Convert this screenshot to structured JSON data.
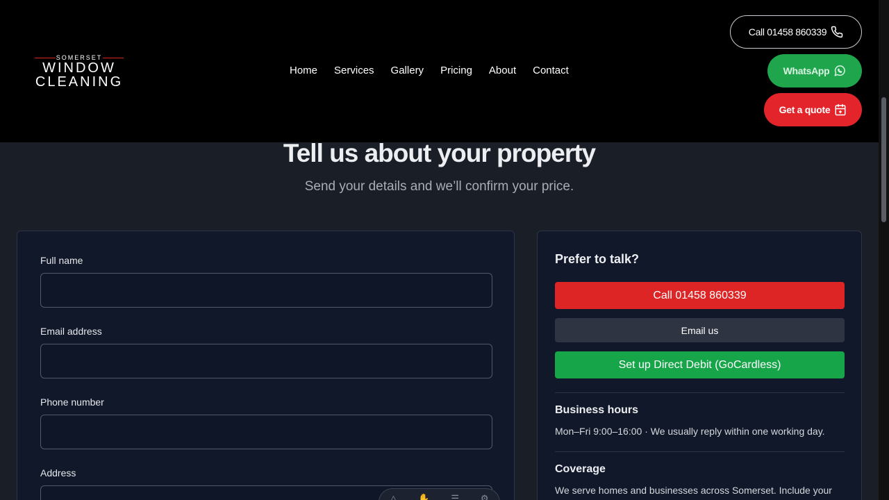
{
  "brand": {
    "logo_top": "SOMERSET",
    "logo_line1": "WINDOW",
    "logo_line2": "CLEANING"
  },
  "nav": {
    "items": [
      "Home",
      "Services",
      "Gallery",
      "Pricing",
      "About",
      "Contact"
    ]
  },
  "header_buttons": {
    "call": "Call 01458 860339",
    "whatsapp": "WhatsApp",
    "quote": "Get a quote"
  },
  "hero": {
    "title": "Tell us about your property",
    "subtitle": "Send your details and we’ll confirm your price."
  },
  "form": {
    "fields": [
      {
        "label": "Full name",
        "value": ""
      },
      {
        "label": "Email address",
        "value": ""
      },
      {
        "label": "Phone number",
        "value": ""
      },
      {
        "label": "Address",
        "value": ""
      }
    ]
  },
  "contact_card": {
    "title": "Prefer to talk?",
    "call_button": "Call 01458 860339",
    "email_button": "Email us",
    "direct_debit_button": "Set up Direct Debit (GoCardless)",
    "hours_title": "Business hours",
    "hours_text": "Mon–Fri 9:00–16:00 · We usually reply within one working day.",
    "coverage_title": "Coverage",
    "coverage_text": "We serve homes and businesses across Somerset. Include your"
  },
  "colors": {
    "accent_red": "#e3242b",
    "accent_green": "#1fa64d",
    "card_bg": "#111829"
  }
}
